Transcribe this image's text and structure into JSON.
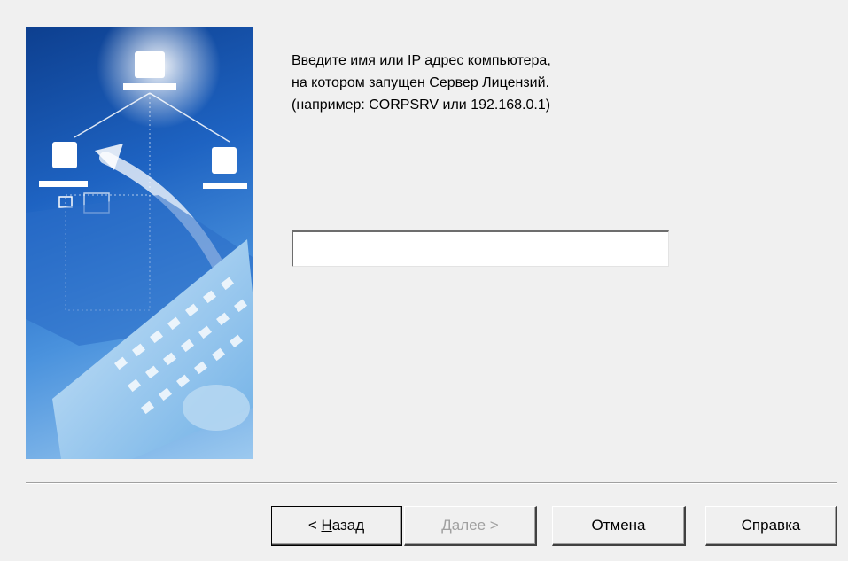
{
  "instructions": {
    "line1": "Введите имя или IP адрес компьютера,",
    "line2": "на котором запущен Сервер Лицензий.",
    "line3": "(например: CORPSRV или 192.168.0.1)"
  },
  "server_input": {
    "value": "",
    "placeholder": ""
  },
  "buttons": {
    "back": {
      "prefix": "< ",
      "mnemonic": "Н",
      "rest": "азад"
    },
    "next": {
      "prefix": "",
      "mnemonic": "Д",
      "rest": "алее >"
    },
    "cancel": {
      "label": "Отмена"
    },
    "help": {
      "label": "Справка"
    }
  },
  "side_image": {
    "description": "network computers and keyboard illustration",
    "colors": {
      "dark": "#0d3f8f",
      "mid": "#1e63c2",
      "light": "#9cc9ef"
    }
  }
}
